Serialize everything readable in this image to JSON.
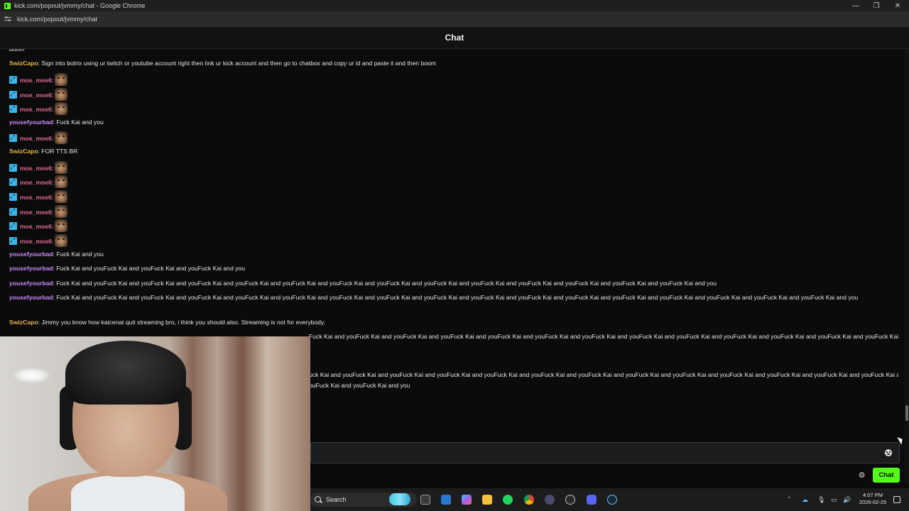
{
  "window": {
    "title": "kick.com/popout/jvmmy/chat - Google Chrome",
    "url": "kick.com/popout/jvmmy/chat",
    "controls": {
      "minimize": "—",
      "restore": "❐",
      "close": "✕"
    }
  },
  "chat": {
    "header_title": "Chat",
    "partial_top_text": "boom",
    "messages": [
      {
        "user": "SwizCapo",
        "text": ": Sign into botrix using ur twitch or youtube account right then link ur kick account and then go to chatbox and copy ur id and paste it and then boom"
      },
      {
        "user": "moe_moe6",
        "text": ":",
        "badge": true,
        "emote": true
      },
      {
        "user": "moe_moe6",
        "text": ":",
        "badge": true,
        "emote": true
      },
      {
        "user": "moe_moe6",
        "text": ":",
        "badge": true,
        "emote": true
      },
      {
        "user": "yousefyourbad",
        "text": ": Fuck Kai and you"
      },
      {
        "user": "moe_moe6",
        "text": ":",
        "badge": true,
        "emote": true
      },
      {
        "user": "SwizCapo",
        "text": ": FOR TTS BR"
      },
      {
        "user": "moe_moe6",
        "text": ":",
        "badge": true,
        "emote": true
      },
      {
        "user": "moe_moe6",
        "text": ":",
        "badge": true,
        "emote": true
      },
      {
        "user": "moe_moe6",
        "text": ":",
        "badge": true,
        "emote": true
      },
      {
        "user": "moe_moe6",
        "text": ":",
        "badge": true,
        "emote": true
      },
      {
        "user": "moe_moe6",
        "text": ":",
        "badge": true,
        "emote": true
      },
      {
        "user": "moe_moe6",
        "text": ":",
        "badge": true,
        "emote": true
      },
      {
        "user": "yousefyourbad",
        "text": ": Fuck Kai and you"
      },
      {
        "user": "yousefyourbad",
        "text": ": Fuck Kai and youFuck Kai and youFuck Kai and youFuck Kai and you"
      },
      {
        "user": "yousefyourbad",
        "text": ": Fuck Kai and youFuck Kai and youFuck Kai and youFuck Kai and youFuck Kai and youFuck Kai and youFuck Kai and youFuck Kai and youFuck Kai and youFuck Kai and youFuck Kai and youFuck Kai and youFuck Kai and youFuck Kai and you"
      },
      {
        "user": "yousefyourbad",
        "text": ": Fuck Kai and youFuck Kai and youFuck Kai and youFuck Kai and youFuck Kai and youFuck Kai and youFuck Kai and youFuck Kai and youFuck Kai and youFuck Kai and youFuck Kai and youFuck Kai and youFuck Kai and youFuck Kai and youFuck Kai and youFuck Kai and youFuck Kai and you"
      },
      {
        "user": "SwizCapo",
        "text": ": Jimmy you know how kaicenat quit streaming bro, i think you should also. Streaming is not for everybody."
      }
    ],
    "partial_line_1": "Fuck Kai and youFuck Kai and youFuck Kai and youFuck Kai and youFuck Kai and youFuck Kai and youFuck Kai and youFuck Kai and youFuck Kai and youFuck Kai and youFuck Kai and youFuck Kai and youFuck Kai and you",
    "partial_line_2": "uck Kai and youFuck Kai and youFuck Kai and youFuck Kai and youFuck Kai and youFuck Kai and youFuck Kai and youFuck Kai and youFuck Kai and youFuck Kai and youFuck Kai and youFuck Kai and youFuck Kai and you",
    "partial_line_3": "ouFuck Kai and youFuck Kai and you",
    "input_placeholder": "",
    "send_label": "Chat",
    "colors": {
      "accent": "#53fc18",
      "swiz": "#e6b450",
      "moe": "#e06891",
      "yousef": "#c88bf5",
      "badge": "#3bb4e8"
    }
  },
  "taskbar": {
    "search_label": "Search",
    "time": "4:07 PM",
    "date": "2026-02-25",
    "icons": [
      "task-view-icon",
      "store-icon",
      "copilot-icon",
      "file-explorer-icon",
      "spotify-icon",
      "chrome-icon",
      "app-icon",
      "obs-icon",
      "discord-icon",
      "steam-icon"
    ],
    "tray": [
      "chevron-up-icon",
      "onedrive-icon",
      "mic-icon",
      "network-icon",
      "volume-icon"
    ]
  }
}
